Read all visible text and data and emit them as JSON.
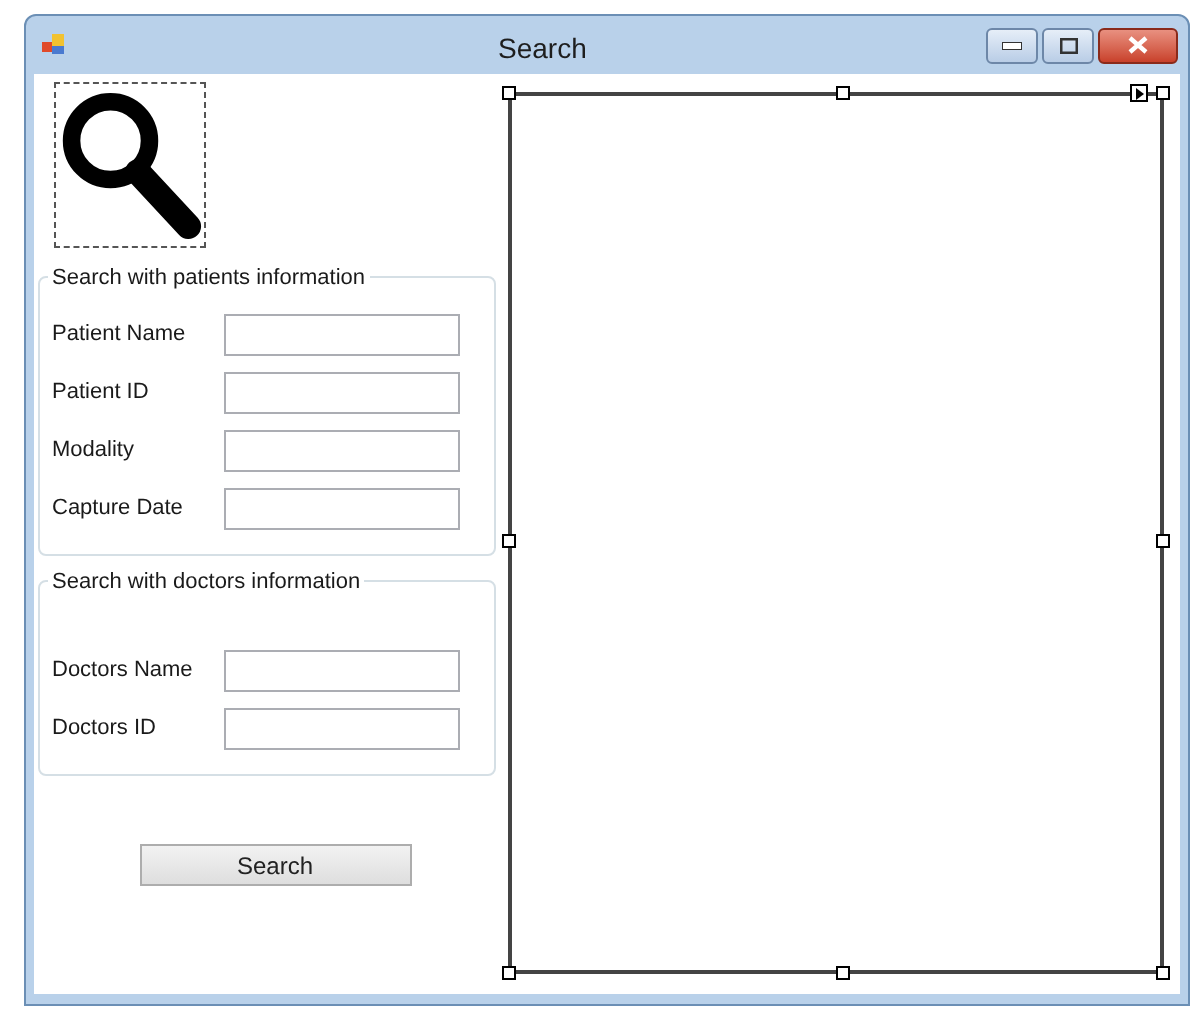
{
  "window": {
    "title": "Search"
  },
  "patient_group": {
    "title": "Search with patients information",
    "fields": [
      {
        "label": "Patient Name"
      },
      {
        "label": "Patient ID"
      },
      {
        "label": "Modality"
      },
      {
        "label": "Capture Date"
      }
    ]
  },
  "doctor_group": {
    "title": "Search with doctors information",
    "fields": [
      {
        "label": "Doctors Name"
      },
      {
        "label": "Doctors ID"
      }
    ]
  },
  "search_button": {
    "label": "Search"
  }
}
